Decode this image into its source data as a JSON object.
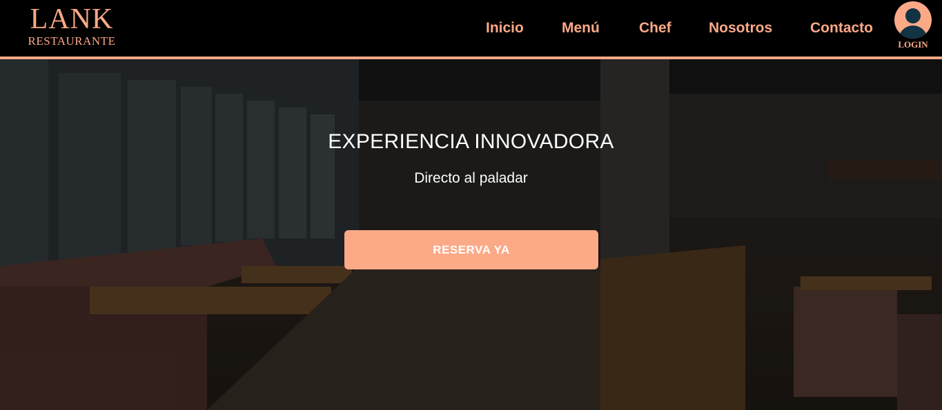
{
  "brand": {
    "name": "LANK",
    "subtitle": "RESTAURANTE"
  },
  "nav": {
    "items": [
      {
        "label": "Inicio"
      },
      {
        "label": "Menú"
      },
      {
        "label": "Chef"
      },
      {
        "label": "Nosotros"
      },
      {
        "label": "Contacto"
      }
    ],
    "login_label": "LOGIN"
  },
  "hero": {
    "title": "EXPERIENCIA INNOVADORA",
    "subtitle": "Directo al paladar",
    "cta_label": "RESERVA YA"
  },
  "colors": {
    "accent": "#fca987",
    "header_bg": "#000000",
    "avatar_figure": "#113344",
    "hero_text": "#ffffff"
  },
  "icons": {
    "login": "user-avatar-icon"
  }
}
